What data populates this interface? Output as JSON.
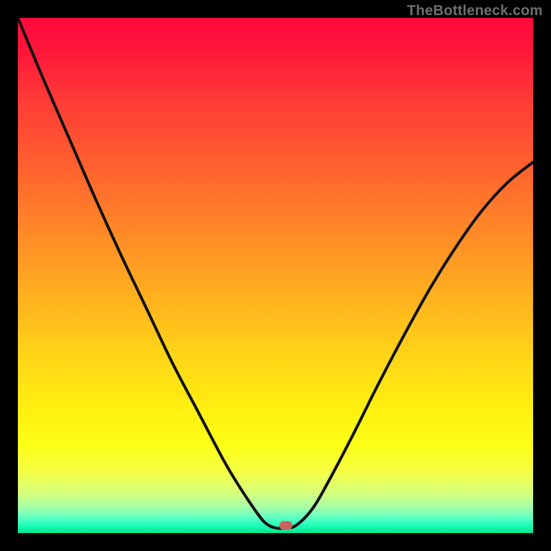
{
  "attribution": "TheBottleneck.com",
  "gradient_colors": {
    "top": "#ff0a3c",
    "mid_upper": "#ff8428",
    "mid": "#fff010",
    "mid_lower": "#d8ff7a",
    "bottom": "#00e58f"
  },
  "marker": {
    "x_frac": 0.52,
    "y_frac": 0.985,
    "color": "#c9635e"
  },
  "chart_data": {
    "type": "line",
    "title": "",
    "xlabel": "",
    "ylabel": "",
    "xlim": [
      0,
      1
    ],
    "ylim": [
      0,
      1
    ],
    "series": [
      {
        "name": "bottleneck-curve",
        "x": [
          0.0,
          0.05,
          0.1,
          0.15,
          0.2,
          0.25,
          0.3,
          0.35,
          0.4,
          0.43,
          0.46,
          0.48,
          0.5,
          0.52,
          0.54,
          0.57,
          0.6,
          0.65,
          0.7,
          0.75,
          0.8,
          0.85,
          0.9,
          0.95,
          1.0
        ],
        "y": [
          1.0,
          0.88,
          0.765,
          0.65,
          0.54,
          0.435,
          0.33,
          0.235,
          0.14,
          0.09,
          0.045,
          0.02,
          0.01,
          0.01,
          0.015,
          0.045,
          0.095,
          0.19,
          0.29,
          0.385,
          0.475,
          0.555,
          0.625,
          0.68,
          0.72
        ]
      }
    ],
    "annotations": [
      {
        "type": "marker",
        "x": 0.52,
        "y": 0.015,
        "label": "optimal-point"
      }
    ]
  }
}
